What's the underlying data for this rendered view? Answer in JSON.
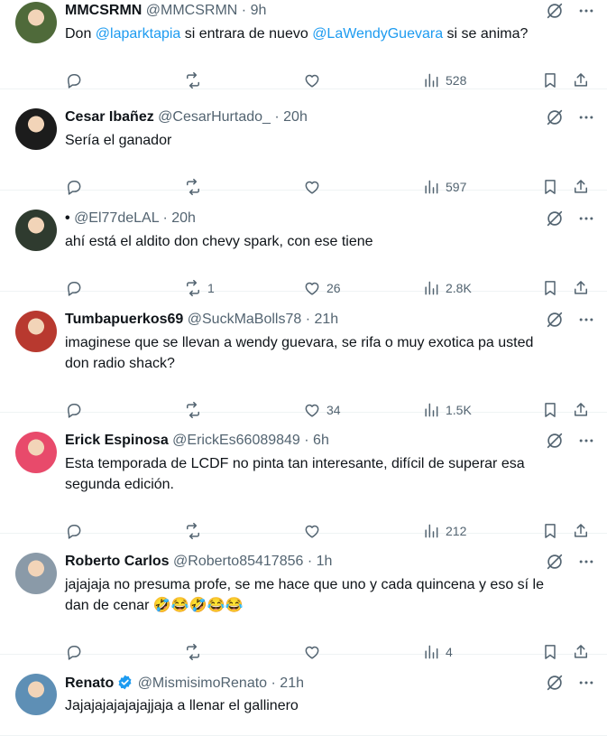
{
  "tweets": [
    {
      "name": "MMCSRMN",
      "handle": "@MMCSRMN",
      "time": "· 9h",
      "verified": false,
      "text_parts": [
        "Don ",
        "@laparktapia",
        " si entrara de nuevo ",
        "@LaWendyGuevara",
        " si se anima?"
      ],
      "replies": "",
      "retweets": "",
      "likes": "",
      "views": "528",
      "avatar_color": "#4f6a3a"
    },
    {
      "name": "Cesar Ibañez",
      "handle": "@CesarHurtado_",
      "time": "· 20h",
      "verified": false,
      "text_lines": [
        "Sería el ganador"
      ],
      "replies": "",
      "retweets": "",
      "likes": "",
      "views": "597",
      "avatar_color": "#1c1c1c"
    },
    {
      "name": "•",
      "handle": "@El77deLAL",
      "time": "· 20h",
      "verified": false,
      "text_lines": [
        "ahí está el aldito don chevy spark, con ese tiene"
      ],
      "replies": "",
      "retweets": "1",
      "likes": "26",
      "views": "2.8K",
      "avatar_color": "#2f3b2f"
    },
    {
      "name": "Tumbapuerkos69",
      "handle": "@SuckMaBolls78",
      "time": "· 21h",
      "verified": false,
      "text_lines": [
        "imaginese que se llevan a wendy guevara, se rifa o muy exotica pa usted",
        "don radio shack?"
      ],
      "replies": "",
      "retweets": "",
      "likes": "34",
      "views": "1.5K",
      "avatar_color": "#b8392f"
    },
    {
      "name": "Erick Espinosa",
      "handle": "@ErickEs66089849",
      "time": "· 6h",
      "verified": false,
      "text_lines": [
        "Esta temporada de LCDF no pinta tan interesante, difícil de superar esa",
        "segunda edición."
      ],
      "replies": "",
      "retweets": "",
      "likes": "",
      "views": "212",
      "avatar_color": "#e84a6b"
    },
    {
      "name": "Roberto Carlos",
      "handle": "@Roberto85417856",
      "time": "· 1h",
      "verified": false,
      "text_lines": [
        "jajajaja no presuma profe, se me hace que uno y cada quincena y eso sí le",
        "dan de cenar 🤣😂🤣😂😂"
      ],
      "replies": "",
      "retweets": "",
      "likes": "",
      "views": "4",
      "avatar_color": "#8a9aa8"
    },
    {
      "name": "Renato",
      "handle": "@MismisimoRenato",
      "time": "· 21h",
      "verified": true,
      "text_lines": [
        "Jajajajajajajajjaja a llenar el gallinero"
      ],
      "replies": "",
      "retweets": "",
      "likes": "",
      "views": "",
      "avatar_color": "#5e8fb5"
    }
  ],
  "icons": {
    "grok": "grok-icon",
    "more": "more-dots-icon",
    "reply": "reply-icon",
    "retweet": "retweet-icon",
    "like": "like-icon",
    "views": "views-icon",
    "bookmark": "bookmark-icon",
    "share": "share-icon",
    "verified": "verified-badge-icon"
  },
  "colors": {
    "accent": "#1d9bf0",
    "secondary_text": "#536471",
    "primary_text": "#0f1419",
    "divider": "#eff3f4"
  }
}
